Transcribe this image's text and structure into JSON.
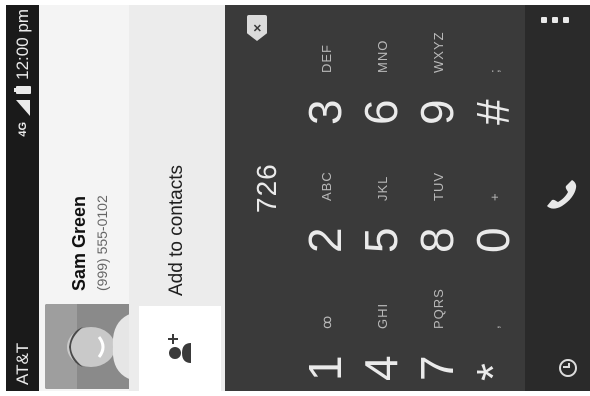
{
  "status_bar": {
    "carrier": "AT&T",
    "network": "4G",
    "time": "12:00 pm"
  },
  "contact_suggestion": {
    "name": "Sam Green",
    "number": "(999) 555-0102"
  },
  "add_to_contacts": {
    "label": "Add to contacts"
  },
  "dialer": {
    "typed_number": "726",
    "delete_label": "×"
  },
  "keypad": {
    "keys": [
      {
        "digit": "1",
        "letters": "ꝏ"
      },
      {
        "digit": "2",
        "letters": "ABC"
      },
      {
        "digit": "3",
        "letters": "DEF"
      },
      {
        "digit": "4",
        "letters": "GHI"
      },
      {
        "digit": "5",
        "letters": "JKL"
      },
      {
        "digit": "6",
        "letters": "MNO"
      },
      {
        "digit": "7",
        "letters": "PQRS"
      },
      {
        "digit": "8",
        "letters": "TUV"
      },
      {
        "digit": "9",
        "letters": "WXYZ"
      },
      {
        "digit": "*",
        "letters": ","
      },
      {
        "digit": "0",
        "letters": "+"
      },
      {
        "digit": "#",
        "letters": ";"
      }
    ]
  },
  "bottom_bar": {
    "icons": [
      "history-icon",
      "phone-call-icon",
      "overflow-menu-icon"
    ]
  },
  "colors": {
    "status_bar_bg": "#1a1a1a",
    "dialer_bg": "#3a3a3a",
    "suggestion_bg": "#f4f4f4"
  }
}
